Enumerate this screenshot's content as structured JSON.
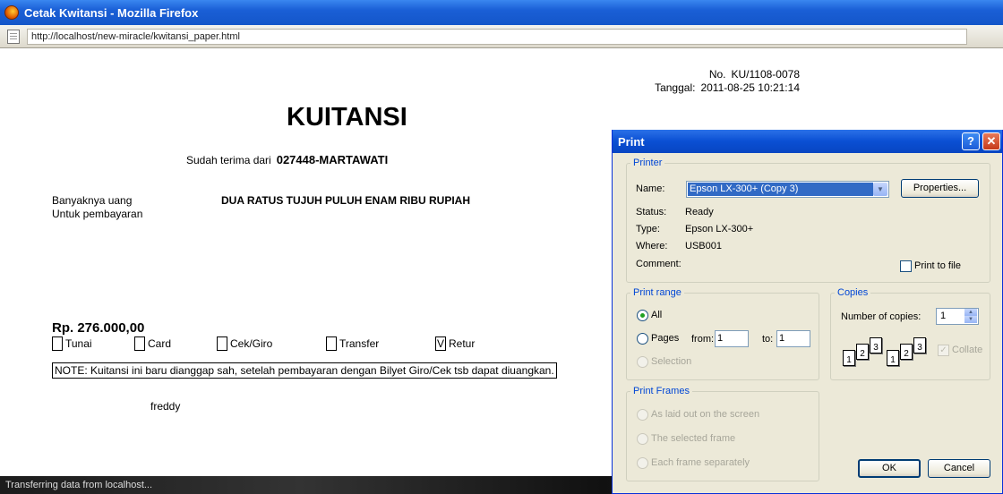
{
  "window": {
    "title": "Cetak Kwitansi - Mozilla Firefox",
    "url": "http://localhost/new-miracle/kwitansi_paper.html",
    "status": "Transferring data from localhost..."
  },
  "doc": {
    "no_label": "No.",
    "no_value": "KU/1108-0078",
    "date_label": "Tanggal:",
    "date_value": "2011-08-25 10:21:14",
    "title": "KUITANSI",
    "received_label": "Sudah terima dari",
    "received_value": "027448-MARTAWATI",
    "amount_label": "Banyaknya uang",
    "purpose_label": "Untuk pembayaran",
    "amount_words": "DUA RATUS TUJUH PULUH ENAM RIBU RUPIAH",
    "amount": "Rp. 276.000,00",
    "options": [
      {
        "label": "Tunai",
        "mark": ""
      },
      {
        "label": "Card",
        "mark": ""
      },
      {
        "label": "Cek/Giro",
        "mark": ""
      },
      {
        "label": "Transfer",
        "mark": ""
      },
      {
        "label": "Retur",
        "mark": "V"
      }
    ],
    "note": "NOTE: Kuitansi ini baru dianggap sah, setelah pembayaran dengan Bilyet Giro/Cek tsb dapat diuangkan.",
    "signer": "freddy"
  },
  "dialog": {
    "title": "Print",
    "help": "?",
    "close": "✕",
    "printer": {
      "legend": "Printer",
      "name_label": "Name:",
      "name_value": "Epson LX-300+ (Copy 3)",
      "properties": "Properties...",
      "status_label": "Status:",
      "status_value": "Ready",
      "type_label": "Type:",
      "type_value": "Epson LX-300+",
      "where_label": "Where:",
      "where_value": "USB001",
      "comment_label": "Comment:",
      "print_to_file": "Print to file"
    },
    "range": {
      "legend": "Print range",
      "all": "All",
      "pages": "Pages",
      "from_label": "from:",
      "from_value": "1",
      "to_label": "to:",
      "to_value": "1",
      "selection": "Selection"
    },
    "copies": {
      "legend": "Copies",
      "number_label": "Number of copies:",
      "number_value": "1",
      "collate": "Collate",
      "collate_mark": "✓",
      "page_nums": [
        "1",
        "2",
        "3"
      ]
    },
    "frames": {
      "legend": "Print Frames",
      "opt1": "As laid out on the screen",
      "opt2": "The selected frame",
      "opt3": "Each frame separately"
    },
    "ok": "OK",
    "cancel": "Cancel"
  }
}
